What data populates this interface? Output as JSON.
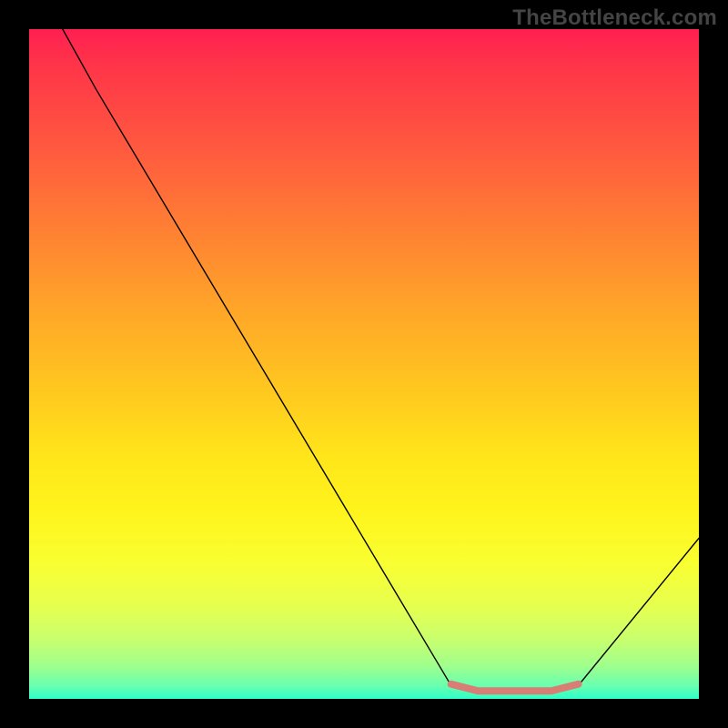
{
  "watermark": "TheBottleneck.com",
  "chart_data": {
    "type": "line",
    "title": "",
    "xlabel": "",
    "ylabel": "",
    "xlim": [
      0,
      100
    ],
    "ylim": [
      0,
      100
    ],
    "series": [
      {
        "name": "curve",
        "color": "#000000",
        "stroke_width": 1.4,
        "points": [
          {
            "x": 5,
            "y": 100
          },
          {
            "x": 10,
            "y": 91
          },
          {
            "x": 63,
            "y": 2
          },
          {
            "x": 67,
            "y": 1
          },
          {
            "x": 78,
            "y": 1
          },
          {
            "x": 82,
            "y": 2
          },
          {
            "x": 100,
            "y": 24
          }
        ]
      },
      {
        "name": "bottom-highlight",
        "color": "#d97e74",
        "stroke_width": 8,
        "points": [
          {
            "x": 63,
            "y": 2.2
          },
          {
            "x": 67,
            "y": 1.2
          },
          {
            "x": 78,
            "y": 1.2
          },
          {
            "x": 82,
            "y": 2.2
          }
        ]
      }
    ],
    "background_gradient": {
      "top_color": "#ff1f52",
      "mid_color": "#ffe61a",
      "bottom_color": "#2fffc9"
    }
  }
}
